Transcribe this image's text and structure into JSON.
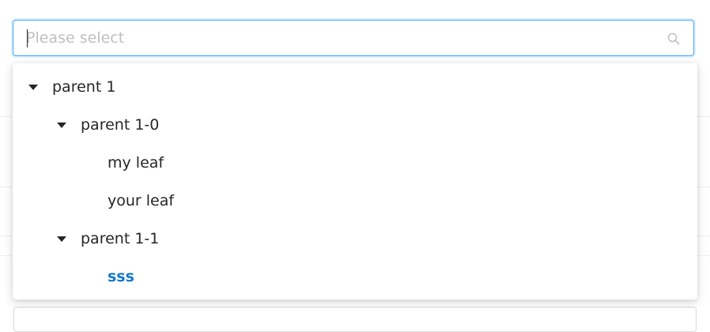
{
  "select": {
    "placeholder": "Please select",
    "value": ""
  },
  "tree": {
    "nodes": [
      {
        "label": "parent 1",
        "expanded": true,
        "level": 0,
        "has_children": true
      },
      {
        "label": "parent 1-0",
        "expanded": true,
        "level": 1,
        "has_children": true
      },
      {
        "label": "my leaf",
        "level": 2,
        "has_children": false
      },
      {
        "label": "your leaf",
        "level": 2,
        "has_children": false
      },
      {
        "label": "parent 1-1",
        "expanded": true,
        "level": 1,
        "has_children": true
      },
      {
        "label": "sss",
        "level": 2,
        "has_children": false,
        "selected": true
      }
    ]
  },
  "colors": {
    "focus_border": "#40a9ff",
    "selected_text": "#1677c8",
    "placeholder": "#bfbfbf"
  }
}
